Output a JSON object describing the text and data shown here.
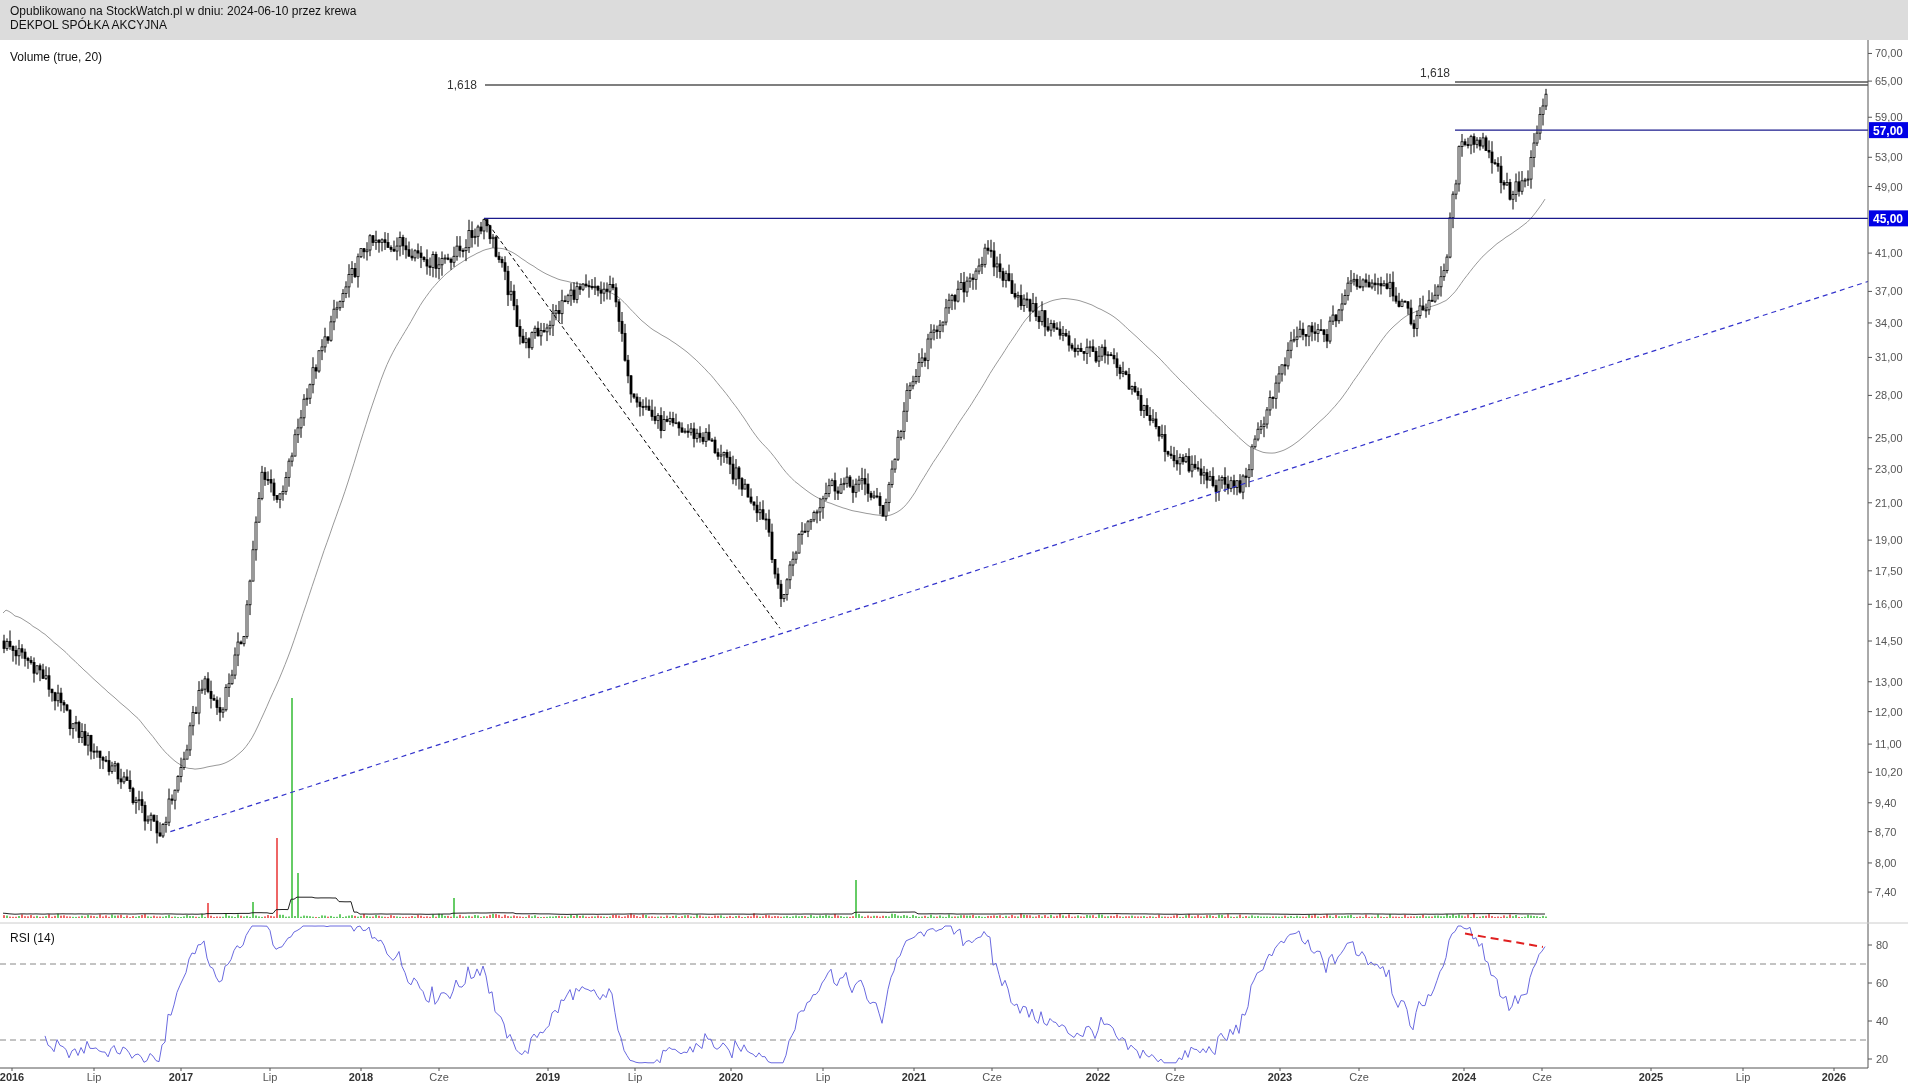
{
  "header": {
    "published": "Opublikowano na StockWatch.pl w dniu: 2024-06-10 przez krewa",
    "instrument": "DEKPOL SPÓŁKA AKCYJNA"
  },
  "price_panel": {
    "indicator_label": "Volume (true, 20)",
    "fib_levels": [
      {
        "label": "1,618"
      },
      {
        "label": "1,618"
      }
    ],
    "price_levels": [
      {
        "label": "57,00"
      },
      {
        "label": "45,00"
      }
    ],
    "y_ticks": [
      "70,00",
      "65,00",
      "59,00",
      "53,00",
      "49,00",
      "41,00",
      "37,00",
      "34,00",
      "31,00",
      "28,00",
      "25,00",
      "23,00",
      "21,00",
      "19,00",
      "17,50",
      "16,00",
      "14,50",
      "13,00",
      "12,00",
      "11,00",
      "10,20",
      "9,40",
      "8,70",
      "8,00",
      "7,40"
    ]
  },
  "rsi_panel": {
    "label": "RSI (14)",
    "y_ticks": [
      "80",
      "60",
      "40",
      "20"
    ]
  },
  "x_axis": {
    "labels": [
      {
        "text": "2016",
        "kind": "year"
      },
      {
        "text": "Lip",
        "kind": "month"
      },
      {
        "text": "2017",
        "kind": "year"
      },
      {
        "text": "Lip",
        "kind": "month"
      },
      {
        "text": "2018",
        "kind": "year"
      },
      {
        "text": "Cze",
        "kind": "month"
      },
      {
        "text": "2019",
        "kind": "year"
      },
      {
        "text": "Lip",
        "kind": "month"
      },
      {
        "text": "2020",
        "kind": "year"
      },
      {
        "text": "Lip",
        "kind": "month"
      },
      {
        "text": "2021",
        "kind": "year"
      },
      {
        "text": "Cze",
        "kind": "month"
      },
      {
        "text": "2022",
        "kind": "year"
      },
      {
        "text": "Cze",
        "kind": "month"
      },
      {
        "text": "2023",
        "kind": "year"
      },
      {
        "text": "Cze",
        "kind": "month"
      },
      {
        "text": "2024",
        "kind": "year"
      },
      {
        "text": "Cze",
        "kind": "month"
      },
      {
        "text": "2025",
        "kind": "year"
      },
      {
        "text": "Lip",
        "kind": "month"
      },
      {
        "text": "2026",
        "kind": "year"
      }
    ]
  }
}
